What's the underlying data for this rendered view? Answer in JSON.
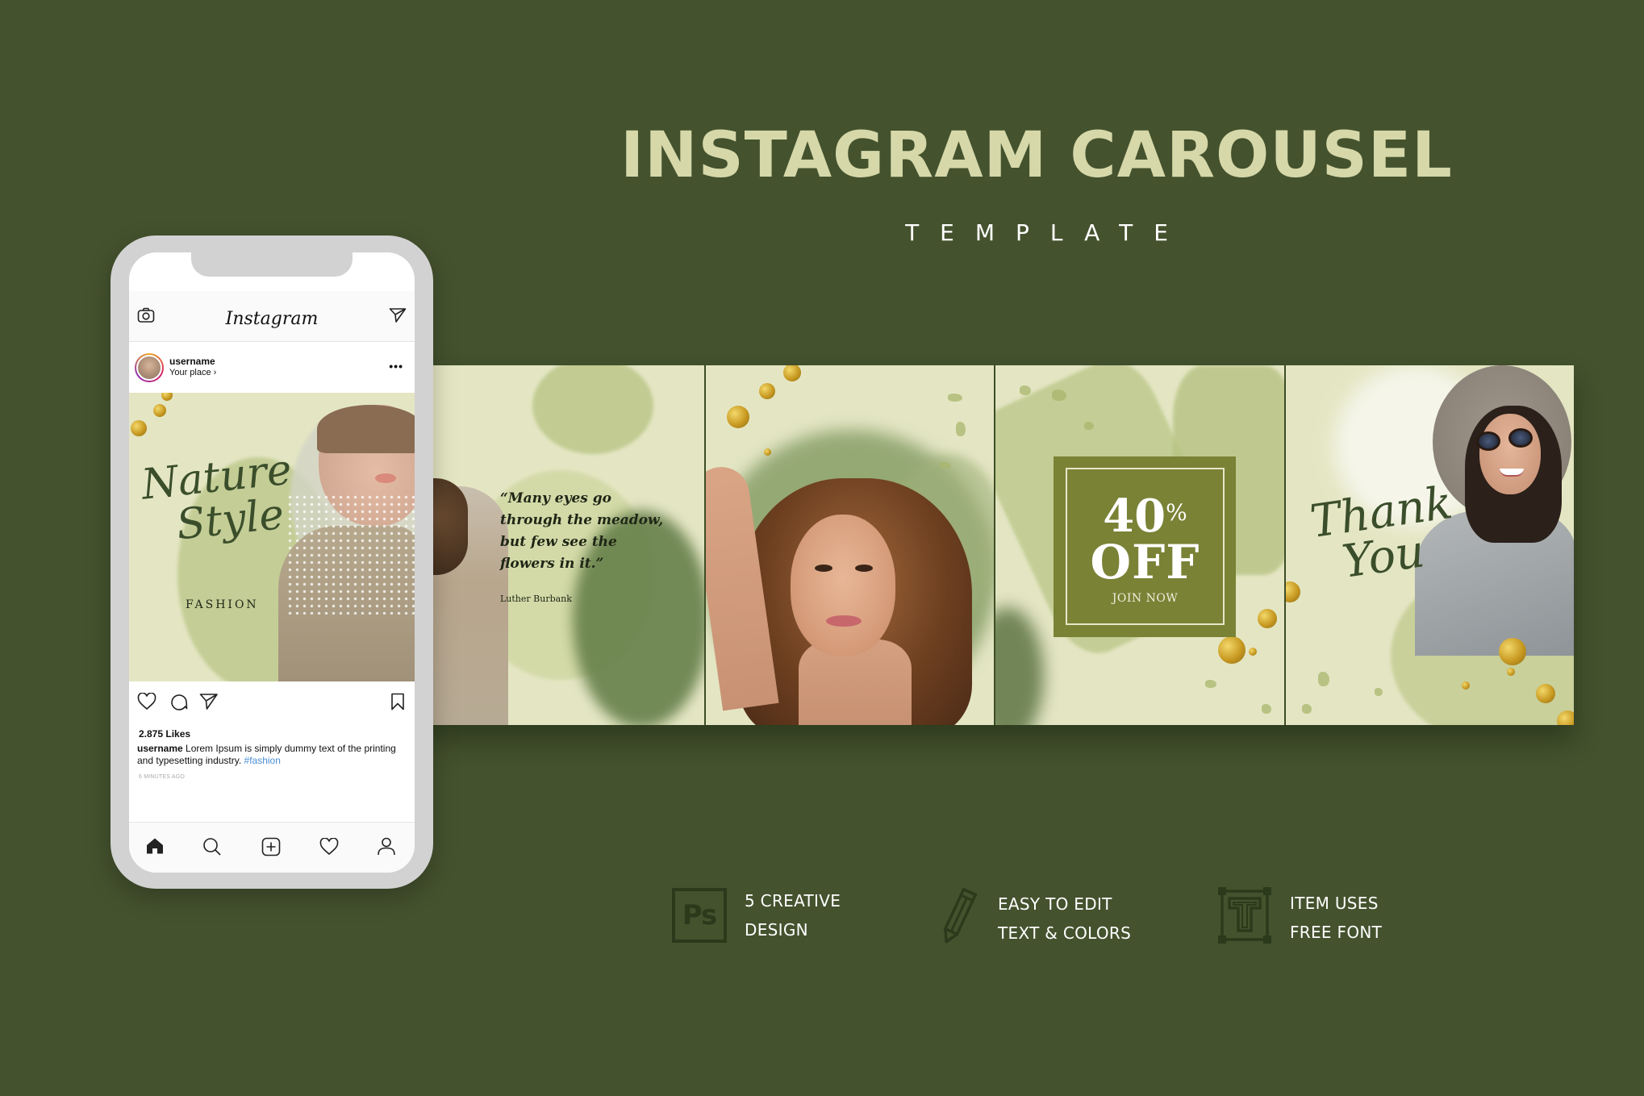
{
  "header": {
    "title": "INSTAGRAM CAROUSEL",
    "subtitle": "TEMPLATE"
  },
  "colors": {
    "background": "#44522e",
    "title": "#d6d8a9",
    "panel_bg": "#e4e6c3",
    "accent_olive": "#7a8236",
    "script_green": "#3b4e2b",
    "gold": "#d4a62a",
    "phone_frame": "#d2d2d2",
    "hashtag": "#4a8fd6"
  },
  "phone": {
    "app_name": "Instagram",
    "icons": {
      "top_left": "camera-icon",
      "top_right": "direct-message-icon"
    },
    "post": {
      "username": "username",
      "location": "Your place",
      "location_chevron": "›",
      "more": "•••",
      "image": {
        "script_line1": "Nature",
        "script_line2": "Style",
        "label": "FASHION"
      },
      "action_icons": [
        "heart-icon",
        "comment-icon",
        "share-icon",
        "bookmark-icon"
      ],
      "likes": "2.875 Likes",
      "caption_user": "username",
      "caption_text": " Lorem Ipsum is simply dummy text of the printing and typesetting industry. ",
      "hashtag": "#fashion",
      "time_ago": "6 MINUTES AGO"
    },
    "bottom_nav": [
      "home-icon",
      "search-icon",
      "add-post-icon",
      "activity-heart-icon",
      "profile-icon"
    ]
  },
  "carousel": {
    "slides": [
      {
        "type": "quote",
        "quote": "“Many eyes go through the meadow, but few see the flowers in it.”",
        "author": "Luther Burbank"
      },
      {
        "type": "portrait"
      },
      {
        "type": "offer",
        "percent": "40",
        "percent_sign": "%",
        "off": "OFF",
        "cta": "JOIN NOW"
      },
      {
        "type": "thanks",
        "line1": "Thank",
        "line2": "You"
      }
    ]
  },
  "features": [
    {
      "icon": "photoshop-icon",
      "icon_text": "Ps",
      "line1": "5 CREATIVE",
      "line2": "DESIGN"
    },
    {
      "icon": "pencil-icon",
      "line1": "EASY TO EDIT",
      "line2": "TEXT & COLORS"
    },
    {
      "icon": "font-type-icon",
      "icon_text": "T",
      "line1": "ITEM USES",
      "line2": "FREE FONT"
    }
  ]
}
